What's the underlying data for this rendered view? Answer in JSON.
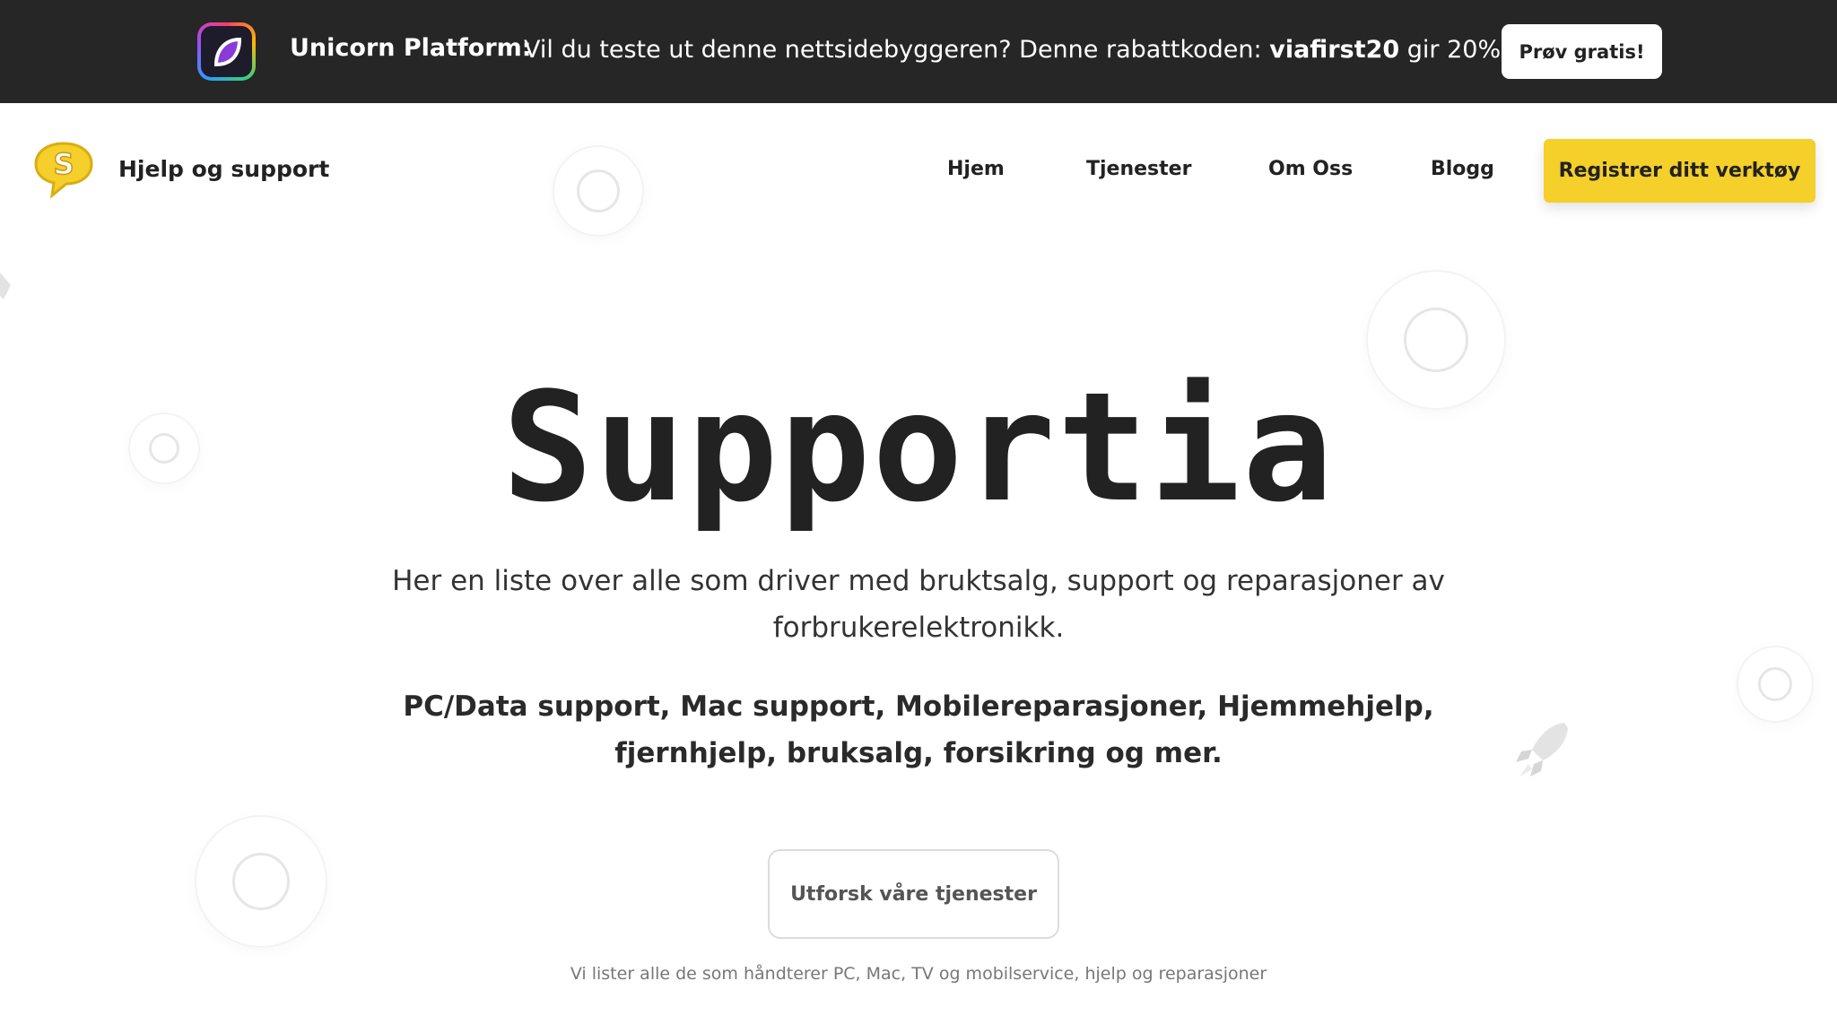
{
  "promo": {
    "brand": "Unicorn Platform:",
    "text_before": "Vil du teste ut denne nettsidebyggeren? Denne rabattkoden: ",
    "code": "viafirst20",
    "text_after": " gir 20%.",
    "button": "Prøv gratis!"
  },
  "nav": {
    "site_name": "Hjelp og support",
    "logo_letter": "S",
    "links": [
      "Hjem",
      "Tjenester",
      "Om Oss",
      "Blogg"
    ],
    "cta": "Registrer ditt verktøy"
  },
  "hero": {
    "title": "Supportia",
    "description": "Her en liste over alle som driver med bruktsalg, support og reparasjoner av forbrukerelektronikk.",
    "services": "PC/Data support, Mac support, Mobilereparasjoner, Hjemmehjelp, fjernhjelp, bruksalg, forsikring og mer.",
    "cta": "Utforsk våre tjenester",
    "footnote": "Vi lister alle de som håndterer PC, Mac, TV og mobilservice, hjelp og reparasjoner"
  },
  "colors": {
    "banner_bg": "#262626",
    "accent_yellow": "#f5cf2a",
    "text_dark": "#222222"
  }
}
